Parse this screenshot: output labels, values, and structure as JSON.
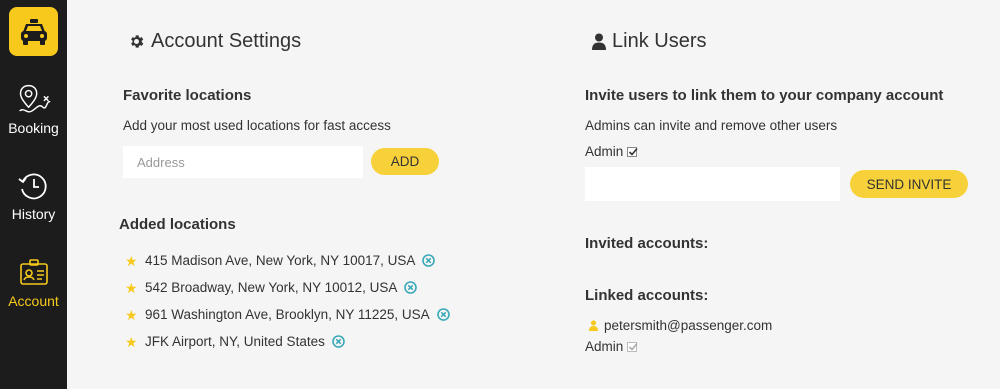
{
  "sidebar": {
    "logo_icon": "taxi-icon",
    "accent": "#f7c91c",
    "items": [
      {
        "label": "Booking",
        "icon": "map-pin-route-icon",
        "active": false
      },
      {
        "label": "History",
        "icon": "history-clock-icon",
        "active": false
      },
      {
        "label": "Account",
        "icon": "id-card-icon",
        "active": true
      }
    ]
  },
  "account_settings": {
    "title": "Account Settings",
    "icon": "gear-icon",
    "favorite_title": "Favorite locations",
    "favorite_desc": "Add your most used locations for fast access",
    "address_placeholder": "Address",
    "add_label": "ADD",
    "added_title": "Added locations",
    "locations": [
      "415 Madison Ave, New York, NY 10017, USA",
      "542 Broadway, New York, NY 10012, USA",
      "961 Washington Ave, Brooklyn, NY 11225, USA",
      "JFK Airport, NY, United States"
    ]
  },
  "link_users": {
    "title": "Link Users",
    "icon": "user-icon",
    "invite_title": "Invite users to link them to your company account",
    "invite_desc": "Admins can invite and remove other users",
    "admin_label": "Admin",
    "admin_checked": true,
    "email_value": "",
    "send_label": "SEND INVITE",
    "invited_title": "Invited accounts:",
    "linked_title": "Linked accounts:",
    "linked_accounts": [
      {
        "email": "petersmith@passenger.com",
        "admin_label": "Admin",
        "admin_checked": true
      }
    ]
  }
}
